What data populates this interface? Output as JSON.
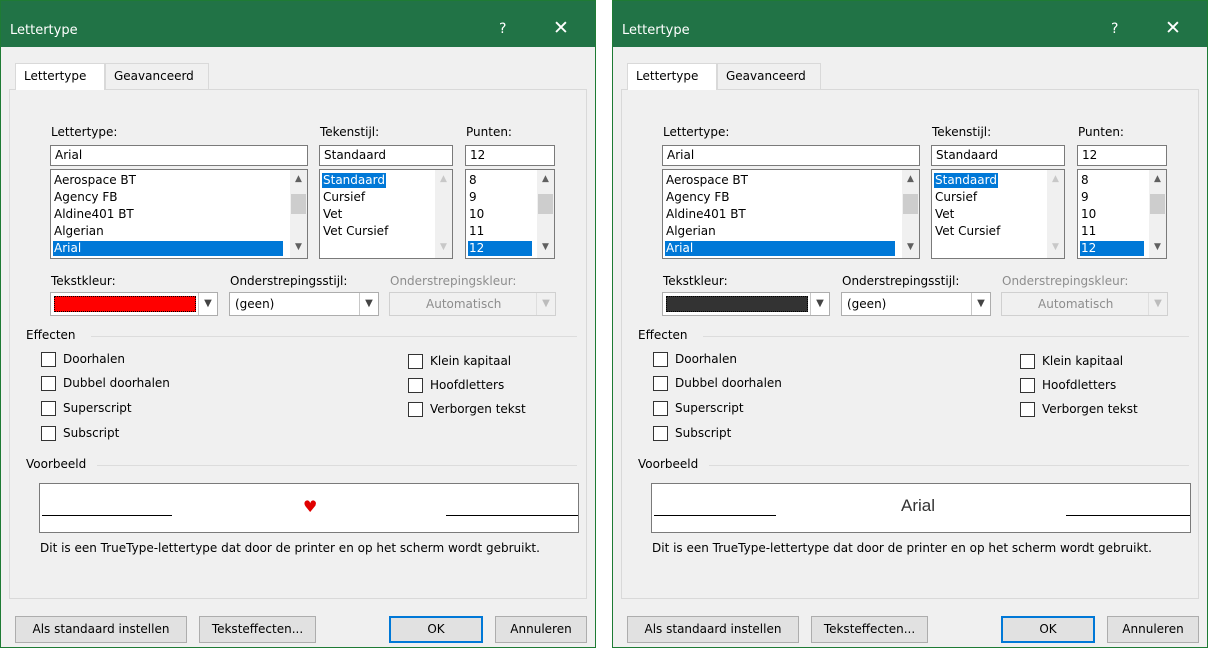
{
  "dialogs": [
    {
      "title": "Lettertype",
      "help_glyph": "?",
      "close_glyph": "✕",
      "tabs": [
        {
          "label": "Lettertype"
        },
        {
          "label": "Geavanceerd"
        }
      ],
      "font": {
        "label": "Lettertype:",
        "value": "Arial",
        "items": [
          "Aerospace BT",
          "Agency FB",
          "Aldine401 BT",
          "Algerian",
          "Arial"
        ],
        "selected_index": 4
      },
      "style": {
        "label": "Tekenstijl:",
        "value": "Standaard",
        "items": [
          "Standaard",
          "Cursief",
          "Vet",
          "Vet Cursief"
        ],
        "selected_index": 0
      },
      "size": {
        "label": "Punten:",
        "value": "12",
        "items": [
          "8",
          "9",
          "10",
          "11",
          "12"
        ],
        "selected_index": 4
      },
      "text_color": {
        "label": "Tekstkleur:",
        "color": "#ff0000"
      },
      "underline_style": {
        "label": "Onderstrepingsstijl:",
        "value": "(geen)"
      },
      "underline_color": {
        "label": "Onderstrepingskleur:",
        "value": "Automatisch"
      },
      "effects": {
        "title": "Effecten",
        "left": [
          "Doorhalen",
          "Dubbel doorhalen",
          "Superscript",
          "Subscript"
        ],
        "right": [
          "Klein kapitaal",
          "Hoofdletters",
          "Verborgen tekst"
        ]
      },
      "preview": {
        "title": "Voorbeeld",
        "sample": "♥",
        "sample_color": "#e00000",
        "caption": "Dit is een TrueType-lettertype dat door de printer en op het scherm wordt gebruikt."
      },
      "buttons": {
        "set_default": "Als standaard instellen",
        "text_effects": "Teksteffecten...",
        "ok": "OK",
        "cancel": "Annuleren"
      }
    },
    {
      "title": "Lettertype",
      "help_glyph": "?",
      "close_glyph": "✕",
      "tabs": [
        {
          "label": "Lettertype"
        },
        {
          "label": "Geavanceerd"
        }
      ],
      "font": {
        "label": "Lettertype:",
        "value": "Arial",
        "items": [
          "Aerospace BT",
          "Agency FB",
          "Aldine401 BT",
          "Algerian",
          "Arial"
        ],
        "selected_index": 4
      },
      "style": {
        "label": "Tekenstijl:",
        "value": "Standaard",
        "items": [
          "Standaard",
          "Cursief",
          "Vet",
          "Vet Cursief"
        ],
        "selected_index": 0
      },
      "size": {
        "label": "Punten:",
        "value": "12",
        "items": [
          "8",
          "9",
          "10",
          "11",
          "12"
        ],
        "selected_index": 4
      },
      "text_color": {
        "label": "Tekstkleur:",
        "color": "#333333"
      },
      "underline_style": {
        "label": "Onderstrepingsstijl:",
        "value": "(geen)"
      },
      "underline_color": {
        "label": "Onderstrepingskleur:",
        "value": "Automatisch"
      },
      "effects": {
        "title": "Effecten",
        "left": [
          "Doorhalen",
          "Dubbel doorhalen",
          "Superscript",
          "Subscript"
        ],
        "right": [
          "Klein kapitaal",
          "Hoofdletters",
          "Verborgen tekst"
        ]
      },
      "preview": {
        "title": "Voorbeeld",
        "sample": "Arial",
        "sample_color": "#333333",
        "caption": "Dit is een TrueType-lettertype dat door de printer en op het scherm wordt gebruikt."
      },
      "buttons": {
        "set_default": "Als standaard instellen",
        "text_effects": "Teksteffecten...",
        "ok": "OK",
        "cancel": "Annuleren"
      }
    }
  ]
}
